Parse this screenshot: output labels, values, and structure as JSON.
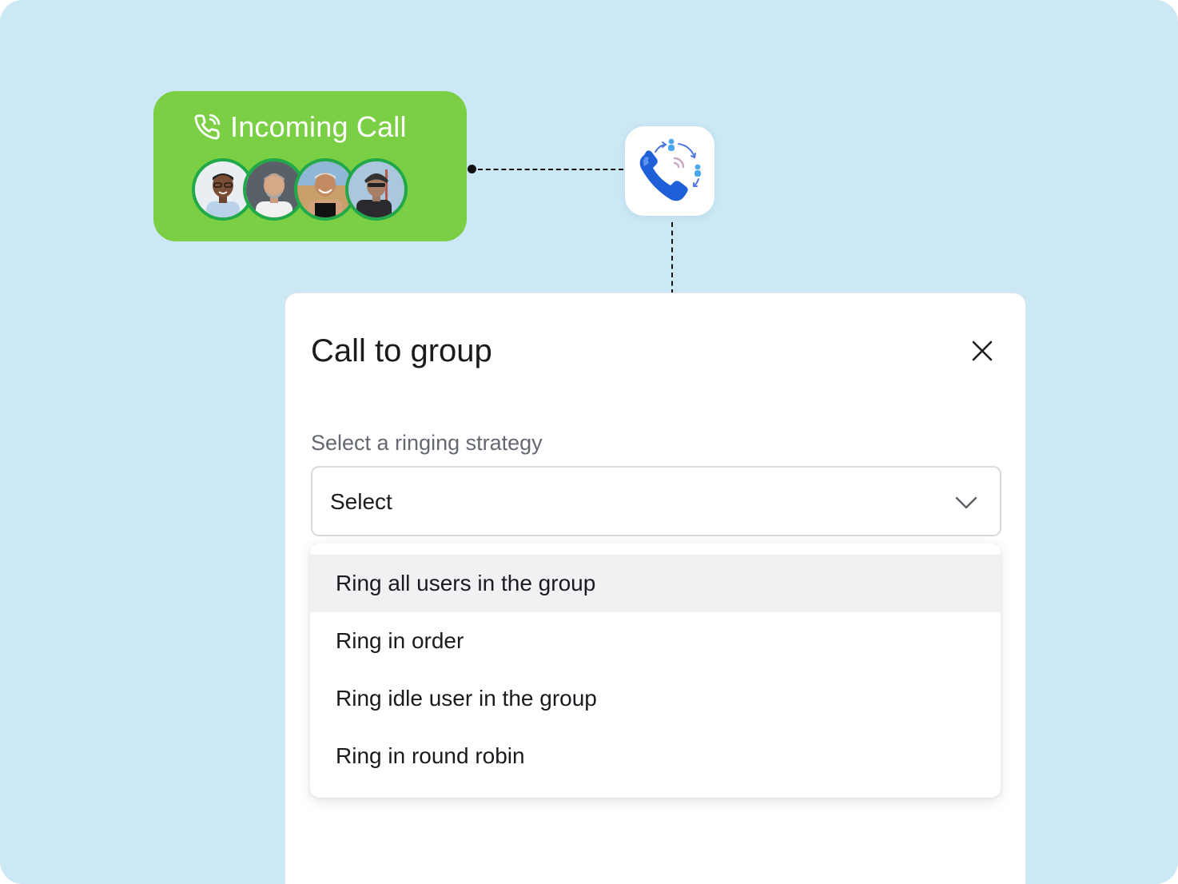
{
  "incoming_call": {
    "title": "Incoming Call",
    "icon": "phone-ringing-icon",
    "avatars": [
      "avatar-1",
      "avatar-2",
      "avatar-3",
      "avatar-4"
    ]
  },
  "app_icon": "call-routing-icon",
  "modal": {
    "title": "Call to group",
    "close_icon": "close-icon",
    "field_label": "Select a ringing strategy",
    "select": {
      "value": "Select",
      "icon": "chevron-down-icon"
    },
    "options": [
      {
        "label": "Ring all users in the group",
        "highlighted": true
      },
      {
        "label": "Ring in order",
        "highlighted": false
      },
      {
        "label": "Ring idle user in the group",
        "highlighted": false
      },
      {
        "label": "Ring in round robin",
        "highlighted": false
      }
    ]
  },
  "colors": {
    "background": "#cde8f5",
    "incoming_card": "#7bcf45",
    "avatar_ring": "#20a84a",
    "icon_blue": "#1f5fd8",
    "option_highlight": "#f0f1f3"
  }
}
